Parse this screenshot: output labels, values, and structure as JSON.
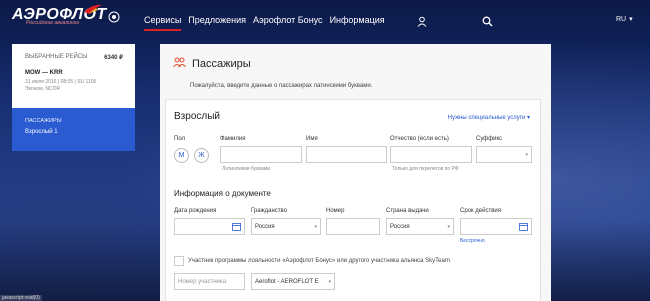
{
  "header": {
    "logo_text": "АЭРОФЛОТ",
    "logo_sub": "Российские авиалинии",
    "nav": [
      "Сервисы",
      "Предложения",
      "Аэрофлот Бонус",
      "Информация"
    ],
    "lang": "RU"
  },
  "sidebar": {
    "selected_label": "ВЫБРАННЫЕ РЕЙСЫ",
    "price": "6340 ₽",
    "route": "MOW — KRR",
    "details": "31 июля 2016 | 08:05 | SU 1106",
    "fare": "Эконом, NCOR",
    "passengers_label": "ПАССАЖИРЫ",
    "passenger_item": "Взрослый 1"
  },
  "main": {
    "title": "Пассажиры",
    "hint": "Пожалуйста, введите данные о пассажирах латинскими буквами.",
    "card_title": "Взрослый",
    "special_services": "Нужны специальные услуги ▾",
    "labels": {
      "gender": "Пол",
      "surname": "Фамилия",
      "name": "Имя",
      "patronymic": "Отчество (если есть)",
      "suffix": "Суффикс",
      "doc_section": "Информация о документе",
      "birth_date": "Дата рождения",
      "citizenship": "Гражданство",
      "number": "Номер",
      "issue_country": "Страна выдачи",
      "validity": "Срок действия"
    },
    "gender_m": "М",
    "gender_f": "Ж",
    "surname_hint": "Латинскими буквами",
    "patronymic_hint": "Только для перелетов по РФ",
    "citizenship_value": "Россия",
    "issue_country_value": "Россия",
    "indefinite": "Бессрочно",
    "loyalty_text": "Участник программы лояльности «Аэрофлот Бонус» или другого участника альянса SkyTeam",
    "member_number_placeholder": "Номер участника",
    "program_value": "Aeroflot - AEROFLOT E"
  },
  "status_url": "javascript:void(0)"
}
